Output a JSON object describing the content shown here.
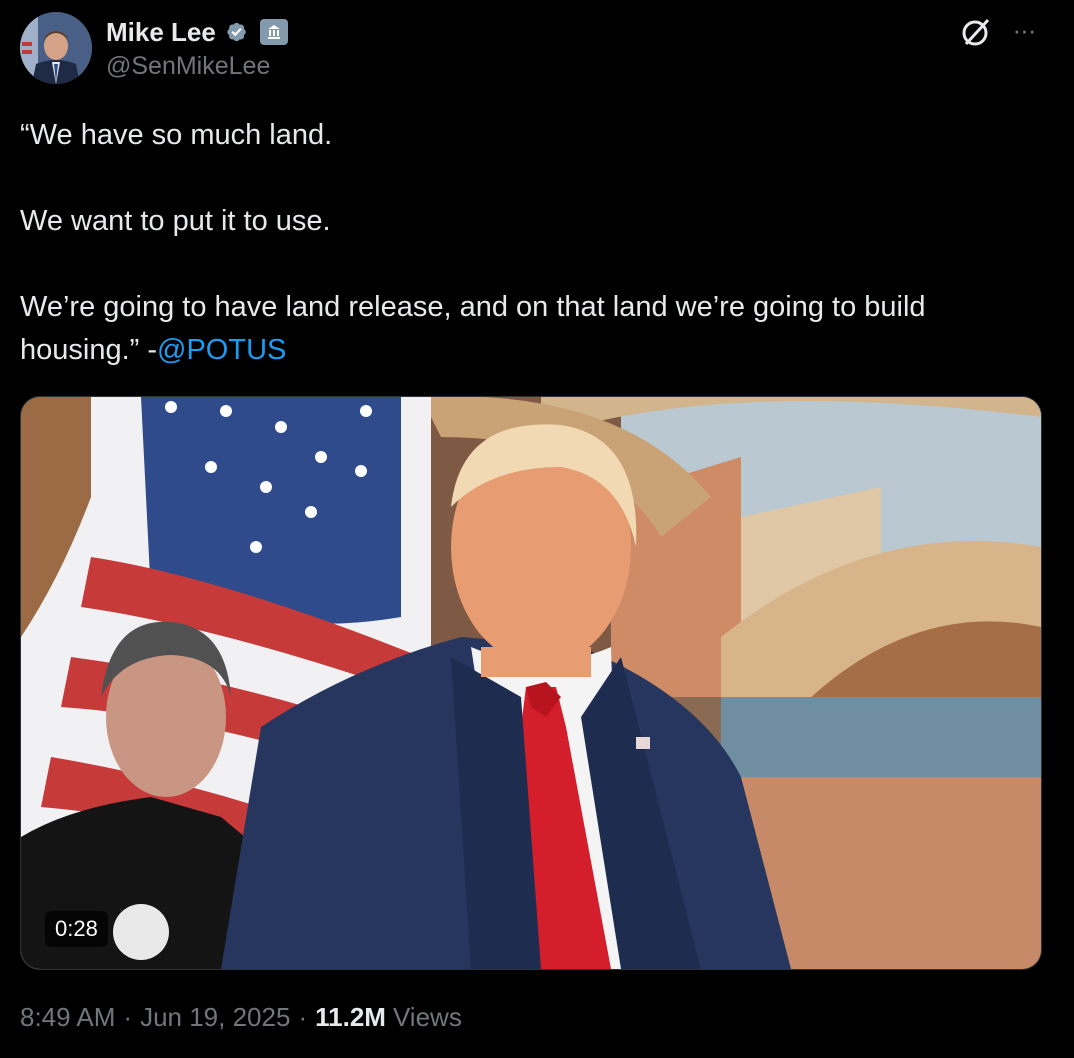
{
  "author": {
    "name": "Mike Lee",
    "handle": "@SenMikeLee",
    "verified_icon": "verified-badge-icon",
    "affiliation_icon": "government-building-icon"
  },
  "header_actions": {
    "grok_icon": "grok-icon",
    "more_icon": "more-options-icon"
  },
  "tweet": {
    "line1": "“We have so much land.",
    "line2": "We want to put it to use.",
    "line3": "We’re going to have land release, and on that land we’re going to build housing.” -",
    "mention": "@POTUS"
  },
  "media": {
    "type": "video",
    "duration": "0:28"
  },
  "meta": {
    "time": "8:49 AM",
    "date": "Jun 19, 2025",
    "views_count": "11.2M",
    "views_label": "Views",
    "separator": "·"
  },
  "colors": {
    "background": "#000000",
    "text": "#e7e9ea",
    "secondary": "#71767b",
    "link": "#1d9bf0",
    "verified": "#829aab"
  }
}
